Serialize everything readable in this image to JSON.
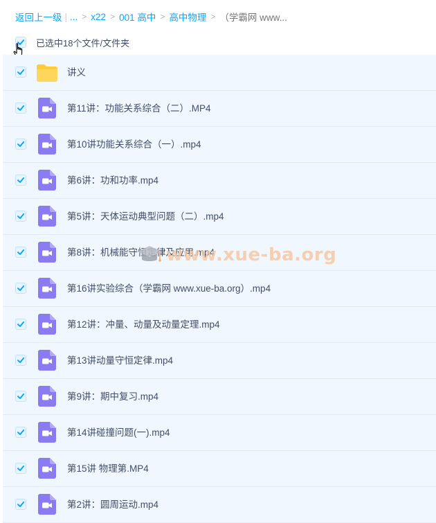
{
  "breadcrumb": {
    "back": "返回上一级",
    "ellipsis": "...",
    "items": [
      "x22",
      "001 高中",
      "高中物理"
    ],
    "current": "（学霸网 www..."
  },
  "selection": {
    "text": "已选中18个文件/文件夹"
  },
  "colors": {
    "accent": "#06a7ff",
    "row_bg": "#f1f7fe",
    "video_icon": "#8a7cf0",
    "folder_icon": "#ffcc33"
  },
  "files": [
    {
      "name": "讲义",
      "icon": "folder-icon"
    },
    {
      "name": "第11讲：功能关系综合（二）.MP4",
      "icon": "video-file-icon"
    },
    {
      "name": "第10讲功能关系综合（一）.mp4",
      "icon": "video-file-icon"
    },
    {
      "name": "第6讲：功和功率.mp4",
      "icon": "video-file-icon"
    },
    {
      "name": "第5讲：天体运动典型问题（二）.mp4",
      "icon": "video-file-icon"
    },
    {
      "name": "第8讲：机械能守恒定律及应用.mp4",
      "icon": "video-file-icon"
    },
    {
      "name": "第16讲实验综合（学霸网 www.xue-ba.org）.mp4",
      "icon": "video-file-icon"
    },
    {
      "name": "第12讲：冲量、动量及动量定理.mp4",
      "icon": "video-file-icon"
    },
    {
      "name": "第13讲动量守恒定律.mp4",
      "icon": "video-file-icon"
    },
    {
      "name": "第9讲：期中复习.mp4",
      "icon": "video-file-icon"
    },
    {
      "name": "第14讲碰撞问题(一).mp4",
      "icon": "video-file-icon"
    },
    {
      "name": "第15讲 物理第.MP4",
      "icon": "video-file-icon"
    },
    {
      "name": "第2讲：圆周运动.mp4",
      "icon": "video-file-icon"
    }
  ],
  "watermark": {
    "text": "www.xue-ba.org"
  }
}
